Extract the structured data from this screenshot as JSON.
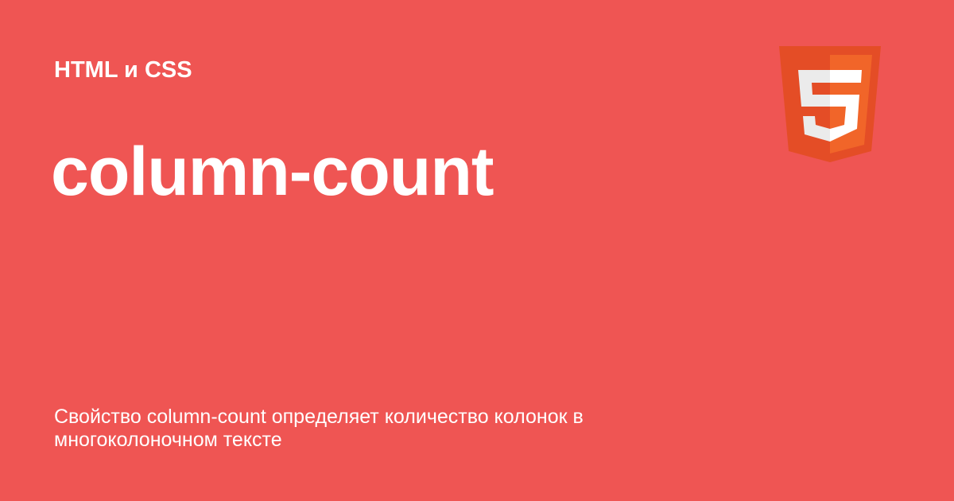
{
  "category": "HTML и CSS",
  "title": "column-count",
  "description": "Свойство column-count определяет количество колонок в многоколоночном тексте",
  "logo": {
    "icon": "html5-icon"
  },
  "colors": {
    "background": "#ef5553",
    "text": "#ffffff",
    "logo_dark": "#e44d26",
    "logo_light": "#f16529",
    "logo_glyph_light": "#ffffff",
    "logo_glyph_shade": "#ebebeb"
  }
}
